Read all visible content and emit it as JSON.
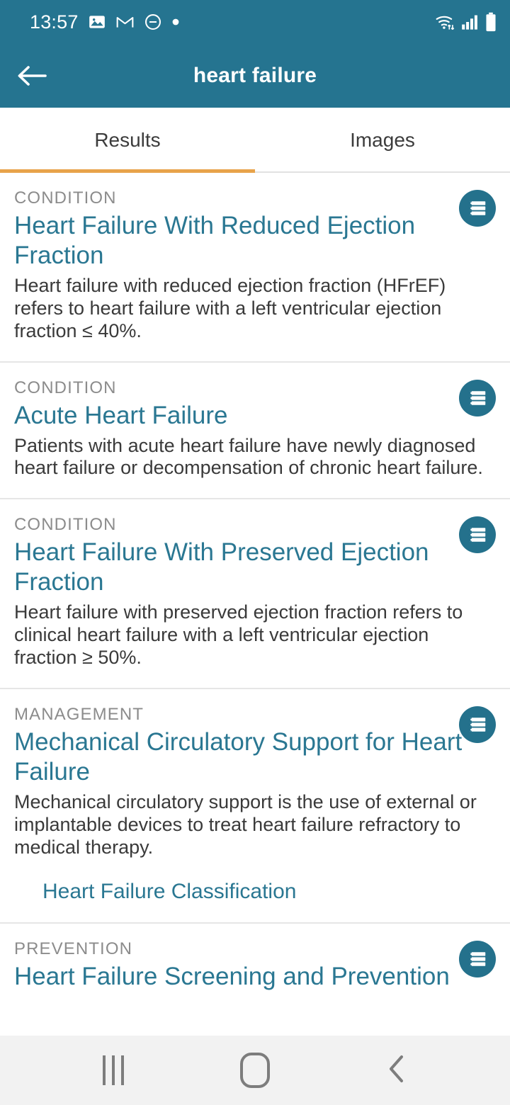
{
  "status_bar": {
    "time": "13:57",
    "left_icons": [
      "photo-icon",
      "gmail-icon",
      "do-not-disturb-icon",
      "dot-indicator-icon"
    ],
    "right_icons": [
      "wifi-icon",
      "cellular-signal-icon",
      "battery-icon"
    ]
  },
  "app_bar": {
    "back_icon": "back-arrow-icon",
    "title": "heart failure"
  },
  "tabs": {
    "active_index": 0,
    "items": [
      {
        "label": "Results"
      },
      {
        "label": "Images"
      }
    ],
    "indicator_color": "#e8a34a"
  },
  "colors": {
    "header_background": "#257490",
    "link": "#2a7792",
    "kicker": "#8c8c8c",
    "body_text": "#3a3a3a",
    "icon_circle": "#24718c",
    "nav_background": "#f2f2f2"
  },
  "results": [
    {
      "kicker": "CONDITION",
      "title": "Heart Failure With Reduced Ejection Fraction",
      "description": "Heart failure with reduced ejection fraction (HFrEF) refers to heart failure with a left ventricular ejection fraction ≤ 40%.",
      "icon": "list-topic-icon",
      "sublink": ""
    },
    {
      "kicker": "CONDITION",
      "title": "Acute Heart Failure",
      "description": "Patients with acute heart failure have newly diagnosed heart failure or decompensation of chronic heart failure.",
      "icon": "list-topic-icon",
      "sublink": ""
    },
    {
      "kicker": "CONDITION",
      "title": "Heart Failure With Preserved Ejection Fraction",
      "description": "Heart failure with preserved ejection fraction refers to clinical heart failure with a left ventricular ejection fraction ≥ 50%.",
      "icon": "list-topic-icon",
      "sublink": ""
    },
    {
      "kicker": "MANAGEMENT",
      "title": "Mechanical Circulatory Support for Heart Failure",
      "description": "Mechanical circulatory support is the use of external or implantable devices to treat heart failure refractory to medical therapy.",
      "icon": "list-topic-icon",
      "sublink": "Heart Failure Classification"
    },
    {
      "kicker": "PREVENTION",
      "title": "Heart Failure Screening and Prevention",
      "description": "",
      "icon": "list-topic-icon",
      "sublink": ""
    }
  ],
  "nav_bar": {
    "recents_label": "recents-button",
    "home_label": "home-button",
    "back_label": "back-button"
  }
}
